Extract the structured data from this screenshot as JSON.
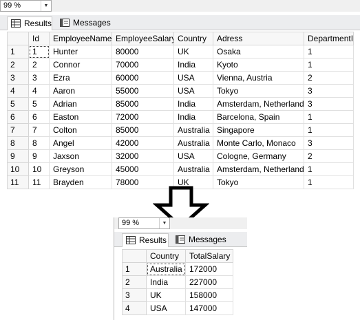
{
  "top": {
    "zoom": "99 %",
    "tabs": [
      {
        "label": "Results"
      },
      {
        "label": "Messages"
      }
    ],
    "columns": [
      "Id",
      "EmployeeName",
      "EmployeeSalary",
      "Country",
      "Adress",
      "DepartmentId"
    ],
    "rows": [
      {
        "n": "1",
        "cells": [
          "1",
          "Hunter",
          "80000",
          "UK",
          "Osaka",
          "1"
        ]
      },
      {
        "n": "2",
        "cells": [
          "2",
          "Connor",
          "70000",
          "India",
          "Kyoto",
          "1"
        ]
      },
      {
        "n": "3",
        "cells": [
          "3",
          "Ezra",
          "60000",
          "USA",
          "Vienna, Austria",
          "2"
        ]
      },
      {
        "n": "4",
        "cells": [
          "4",
          "Aaron",
          "55000",
          "USA",
          "Tokyo",
          "3"
        ]
      },
      {
        "n": "5",
        "cells": [
          "5",
          "Adrian",
          "85000",
          "India",
          "Amsterdam, Netherlands",
          "3"
        ]
      },
      {
        "n": "6",
        "cells": [
          "6",
          "Easton",
          "72000",
          "India",
          "Barcelona, Spain",
          "1"
        ]
      },
      {
        "n": "7",
        "cells": [
          "7",
          "Colton",
          "85000",
          "Australia",
          "Singapore",
          "1"
        ]
      },
      {
        "n": "8",
        "cells": [
          "8",
          "Angel",
          "42000",
          "Australia",
          "Monte Carlo, Monaco",
          "3"
        ]
      },
      {
        "n": "9",
        "cells": [
          "9",
          "Jaxson",
          "32000",
          "USA",
          "Cologne, Germany",
          "2"
        ]
      },
      {
        "n": "10",
        "cells": [
          "10",
          "Greyson",
          "45000",
          "Australia",
          "Amsterdam, Netherlands",
          "1"
        ]
      },
      {
        "n": "11",
        "cells": [
          "11",
          "Brayden",
          "78000",
          "UK",
          "Tokyo",
          "1"
        ]
      }
    ]
  },
  "bottom": {
    "zoom": "99 %",
    "tabs": [
      {
        "label": "Results"
      },
      {
        "label": "Messages"
      }
    ],
    "columns": [
      "Country",
      "TotalSalary"
    ],
    "rows": [
      {
        "n": "1",
        "cells": [
          "Australia",
          "172000"
        ]
      },
      {
        "n": "2",
        "cells": [
          "India",
          "227000"
        ]
      },
      {
        "n": "3",
        "cells": [
          "UK",
          "158000"
        ]
      },
      {
        "n": "4",
        "cells": [
          "USA",
          "147000"
        ]
      }
    ]
  },
  "icons": {
    "results_tab": "grid-icon",
    "messages_tab": "messages-icon",
    "zoom_dropdown": "chevron-down-icon",
    "transition": "down-arrow-icon"
  }
}
